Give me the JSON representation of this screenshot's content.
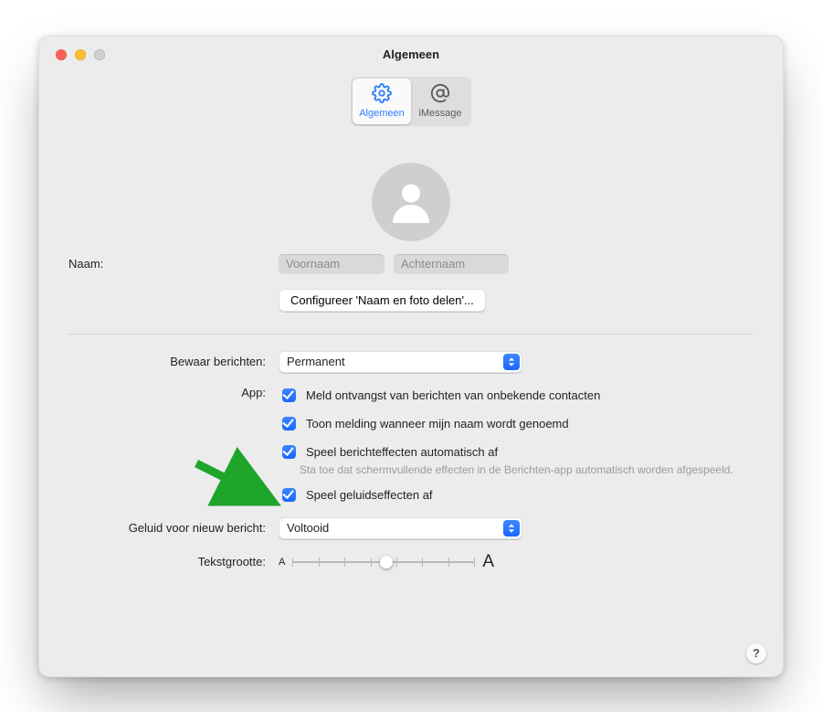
{
  "window": {
    "title": "Algemeen"
  },
  "tabs": {
    "general": {
      "label": "Algemeen",
      "active": true
    },
    "imessage": {
      "label": "iMessage",
      "active": false
    }
  },
  "profile": {
    "name_label": "Naam:",
    "first_placeholder": "Voornaam",
    "last_placeholder": "Achternaam",
    "share_button": "Configureer 'Naam en foto delen'..."
  },
  "settings": {
    "keep_messages_label": "Bewaar berichten:",
    "keep_messages_value": "Permanent",
    "app_label": "App:",
    "checks": {
      "notify_unknown": {
        "label": "Meld ontvangst van berichten van onbekende contacten",
        "checked": true
      },
      "notify_name": {
        "label": "Toon melding wanneer mijn naam wordt genoemd",
        "checked": true
      },
      "auto_effects": {
        "label": "Speel berichteffecten automatisch af",
        "sub": "Sta toe dat schermvullende effecten in de Berichten-app automatisch worden afgespeeld.",
        "checked": true
      },
      "sound_effects": {
        "label": "Speel geluidseffecten af",
        "checked": true
      }
    },
    "sound_label": "Geluid voor nieuw bericht:",
    "sound_value": "Voltooid",
    "textsize_label": "Tekstgrootte:"
  },
  "help_tooltip": "?"
}
